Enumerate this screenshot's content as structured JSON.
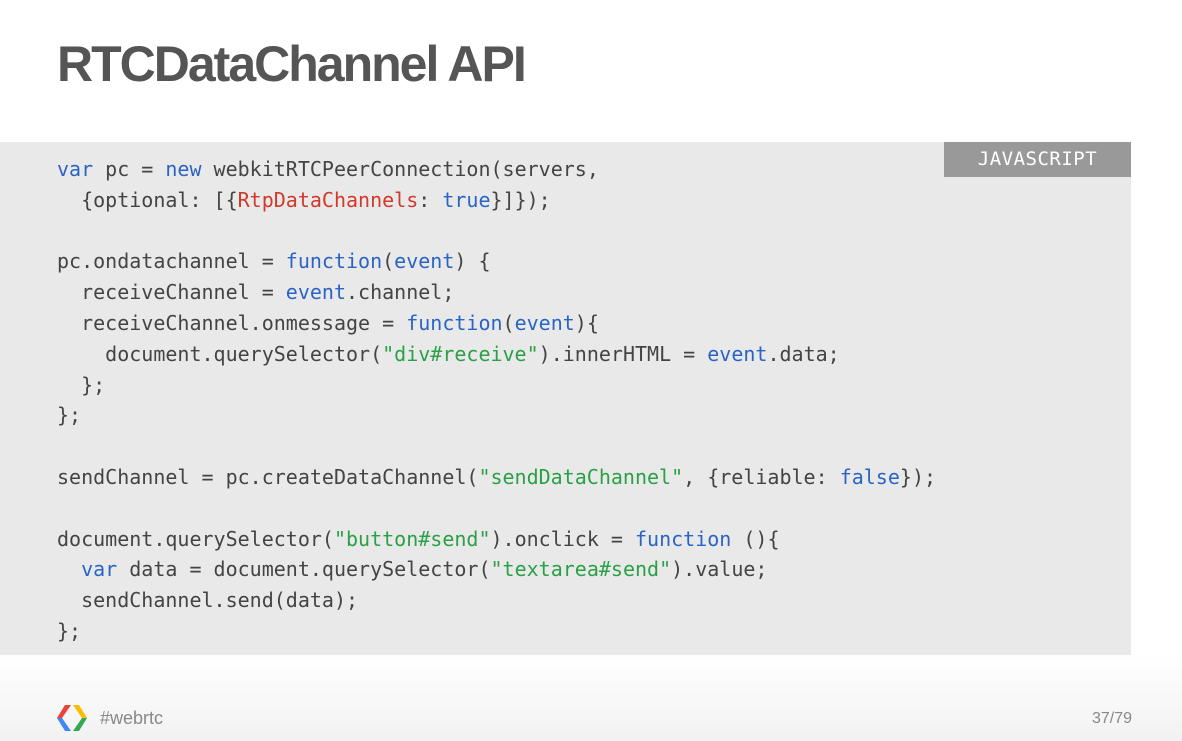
{
  "slide": {
    "title": "RTCDataChannel API"
  },
  "code_block": {
    "language_label": "JAVASCRIPT",
    "lines": [
      [
        [
          "var",
          "kw"
        ],
        [
          " pc = ",
          ""
        ],
        [
          "new",
          "kw"
        ],
        [
          " webkitRTCPeerConnection(servers,",
          ""
        ]
      ],
      [
        [
          "  {optional: [{",
          ""
        ],
        [
          "RtpDataChannels",
          "prop"
        ],
        [
          ": ",
          ""
        ],
        [
          "true",
          "kw"
        ],
        [
          "}]});",
          ""
        ]
      ],
      [],
      [
        [
          "pc.ondatachannel = ",
          ""
        ],
        [
          "function",
          "kw"
        ],
        [
          "(",
          ""
        ],
        [
          "event",
          "kw"
        ],
        [
          ") {",
          ""
        ]
      ],
      [
        [
          "  receiveChannel = ",
          ""
        ],
        [
          "event",
          "kw"
        ],
        [
          ".channel;",
          ""
        ]
      ],
      [
        [
          "  receiveChannel.onmessage = ",
          ""
        ],
        [
          "function",
          "kw"
        ],
        [
          "(",
          ""
        ],
        [
          "event",
          "kw"
        ],
        [
          "){",
          ""
        ]
      ],
      [
        [
          "    document.querySelector(",
          ""
        ],
        [
          "\"div#receive\"",
          "str"
        ],
        [
          ").innerHTML = ",
          ""
        ],
        [
          "event",
          "kw"
        ],
        [
          ".data;",
          ""
        ]
      ],
      [
        [
          "  };",
          ""
        ]
      ],
      [
        [
          "};",
          ""
        ]
      ],
      [],
      [
        [
          "sendChannel = pc.createDataChannel(",
          ""
        ],
        [
          "\"sendDataChannel\"",
          "str"
        ],
        [
          ", {reliable: ",
          ""
        ],
        [
          "false",
          "kw"
        ],
        [
          "});",
          ""
        ]
      ],
      [],
      [
        [
          "document.querySelector(",
          ""
        ],
        [
          "\"button#send\"",
          "str"
        ],
        [
          ").onclick = ",
          ""
        ],
        [
          "function",
          "kw"
        ],
        [
          " (){",
          ""
        ]
      ],
      [
        [
          "  ",
          ""
        ],
        [
          "var",
          "kw"
        ],
        [
          " data = document.querySelector(",
          ""
        ],
        [
          "\"textarea#send\"",
          "str"
        ],
        [
          ").value;",
          ""
        ]
      ],
      [
        [
          "  sendChannel.send(data);",
          ""
        ]
      ],
      [
        [
          "};",
          ""
        ]
      ]
    ]
  },
  "footer": {
    "hashtag": "#webrtc",
    "page_indicator": "37/79",
    "logo_icon": "google-developers-logo-icon"
  },
  "colors": {
    "keyword": "#2a64c4",
    "string": "#2aa047",
    "property": "#d2392a",
    "code_background": "#e9e9e9",
    "badge_background": "#999999"
  }
}
